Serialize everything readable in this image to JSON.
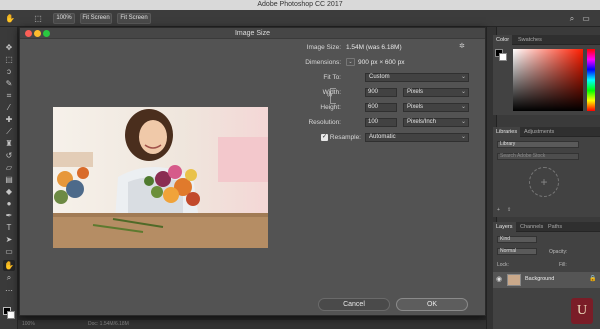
{
  "app": {
    "title": "Adobe Photoshop CC 2017"
  },
  "options_bar": {
    "zoom": "100%",
    "fit1": "Fit Screen",
    "fit2": "Fit Screen"
  },
  "dialog": {
    "title": "Image Size",
    "image_size_label": "Image Size:",
    "image_size_value": "1.54M (was 6.18M)",
    "dimensions_label": "Dimensions:",
    "dimensions_value": "900 px  ×  600 px",
    "fit_to_label": "Fit To:",
    "fit_to_value": "Custom",
    "width_label": "Width:",
    "width_value": "900",
    "width_unit": "Pixels",
    "height_label": "Height:",
    "height_value": "600",
    "height_unit": "Pixels",
    "resolution_label": "Resolution:",
    "resolution_value": "100",
    "resolution_unit": "Pixels/Inch",
    "resample_label": "Resample:",
    "resample_checked": true,
    "resample_value": "Automatic",
    "cancel": "Cancel",
    "ok": "OK"
  },
  "panels": {
    "color_tab": "Color",
    "swatches_tab": "Swatches",
    "libraries_tab": "Libraries",
    "adjustments_tab": "Adjustments",
    "library_select": "Library",
    "library_search": "Search Adobe Stock",
    "layers_tab": "Layers",
    "channels_tab": "Channels",
    "paths_tab": "Paths",
    "layer_kind": "Kind",
    "blend_mode": "Normal",
    "opacity_label": "Opacity:",
    "lock_label": "Lock:",
    "fill_label": "Fill:",
    "layer_name": "Background"
  },
  "status": {
    "zoom": "100%",
    "doc": "Doc: 1.54M/6.18M"
  },
  "colors": {
    "accent": "#e23a25",
    "dialog_bg": "#535353",
    "panel_bg": "#424242"
  },
  "icons": [
    "move-tool-icon",
    "marquee-tool-icon",
    "lasso-tool-icon",
    "quick-select-icon",
    "crop-tool-icon",
    "eyedropper-icon",
    "healing-brush-icon",
    "brush-icon",
    "clone-stamp-icon",
    "history-brush-icon",
    "eraser-icon",
    "gradient-icon",
    "blur-icon",
    "dodge-icon",
    "pen-tool-icon",
    "type-tool-icon",
    "path-select-icon",
    "shape-tool-icon",
    "hand-tool-icon",
    "zoom-tool-icon",
    "link-icon",
    "gear-icon",
    "eye-icon",
    "lock-icon"
  ]
}
